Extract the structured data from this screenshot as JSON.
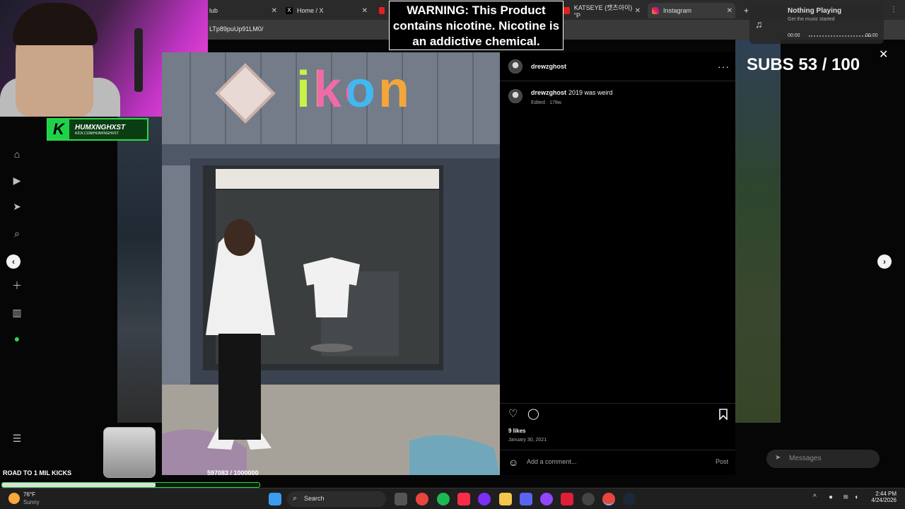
{
  "browser": {
    "tabs": [
      {
        "label": "lub",
        "favicon": "github-icon"
      },
      {
        "label": "Home / X",
        "favicon": "x-icon"
      },
      {
        "label": "",
        "favicon": "youtube-icon"
      },
      {
        "label": "KATSEYE (캣츠아이) \"P",
        "favicon": "youtube-icon"
      },
      {
        "label": "Instagram",
        "favicon": "instagram-icon"
      }
    ],
    "url": "LTp89puUp91LM0/"
  },
  "overlays": {
    "warning_text": "WARNING: This Product contains nicotine. Nicotine is an addictive chemical.",
    "subs_goal": "SUBS 53 / 100",
    "kick_name": "HUMXNGHXST",
    "kick_url": "KICK.COM/HUMXNGHXST",
    "kick_logo": "K",
    "road_label": "ROAD TO 1 MIL KICKS",
    "road_count": "597083 / 1000000",
    "road_progress": 0.597083,
    "music": {
      "title": "Nothing Playing",
      "subtitle": "Get the music started",
      "time_start": "00:00",
      "time_end": "00:00"
    }
  },
  "post": {
    "username": "drewzghost",
    "caption_user": "drewzghost",
    "caption_text": "2019 was weird",
    "edited": "Edited · 178w",
    "likes": "9 likes",
    "date": "January 30, 2021",
    "comment_placeholder": "Add a comment...",
    "post_button": "Post",
    "sign_text": "ikon"
  },
  "messages_label": "Messages",
  "taskbar": {
    "temperature": "76°F",
    "weather": "Sunny",
    "search_label": "Search",
    "time": "2:44 PM",
    "date": "4/24/2026"
  },
  "colors": {
    "accent_green": "#2bd84a",
    "warning_bg": "#000000",
    "panel_bg": "#000000"
  }
}
